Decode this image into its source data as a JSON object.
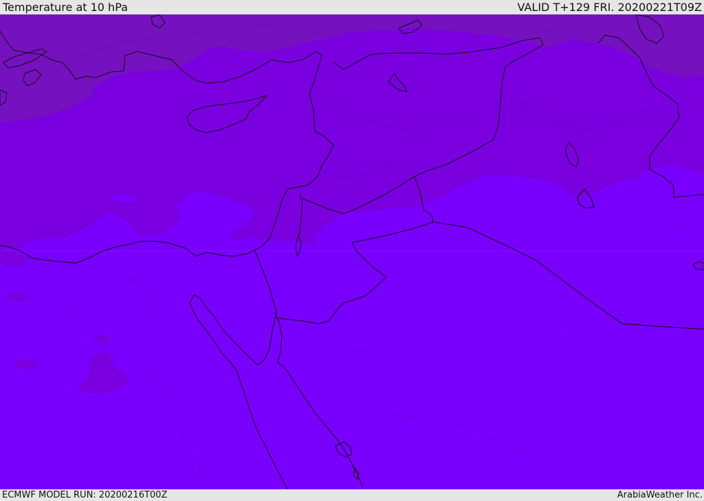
{
  "header": {
    "title": "Temperature at 10 hPa",
    "valid_time": "VALID T+129 FRI. 20200221T09Z"
  },
  "footer": {
    "model_run": "ECMWF MODEL RUN: 20200216T00Z",
    "credit": "ArabiaWeather Inc."
  },
  "colors": {
    "warmest_band": "#7611c0",
    "mid_band": "#7a00e0",
    "coldest_band": "#7a00fd",
    "border_line": "#111111"
  }
}
